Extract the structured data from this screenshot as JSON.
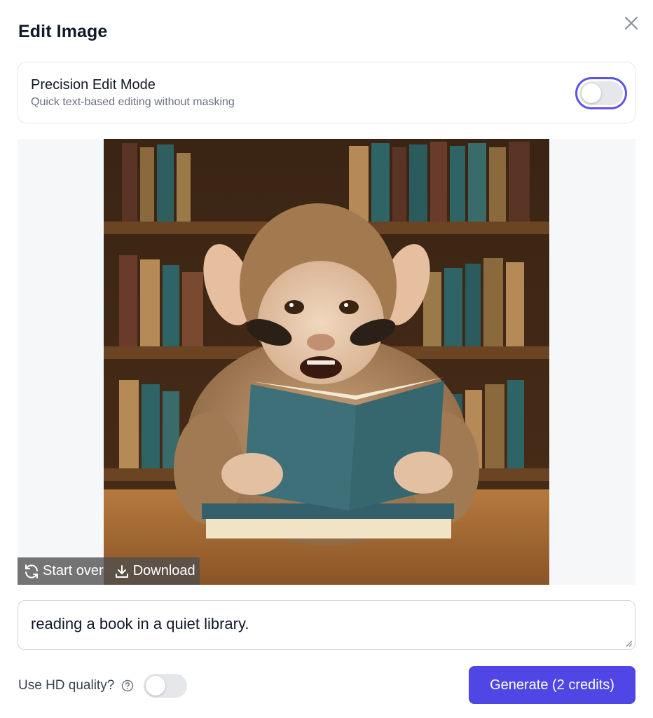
{
  "dialog": {
    "title": "Edit Image",
    "close_icon": "close-icon"
  },
  "precision_mode": {
    "title": "Precision Edit Mode",
    "subtitle": "Quick text-based editing without masking",
    "enabled": false
  },
  "image": {
    "subject": "photo-of-monkey-reading-book",
    "toolbar": {
      "start_over_label": "Start over",
      "start_over_icon": "refresh-icon",
      "download_label": "Download",
      "download_icon": "download-icon"
    }
  },
  "prompt": {
    "value": "reading a book in a quiet library."
  },
  "hd_quality": {
    "label": "Use HD quality?",
    "help_icon": "help-circle-icon",
    "enabled": false
  },
  "generate": {
    "label": "Generate (2 credits)"
  },
  "colors": {
    "accent": "#4f46e5",
    "toggle_off": "#e5e7eb",
    "focus_ring": "#5b55e8"
  }
}
